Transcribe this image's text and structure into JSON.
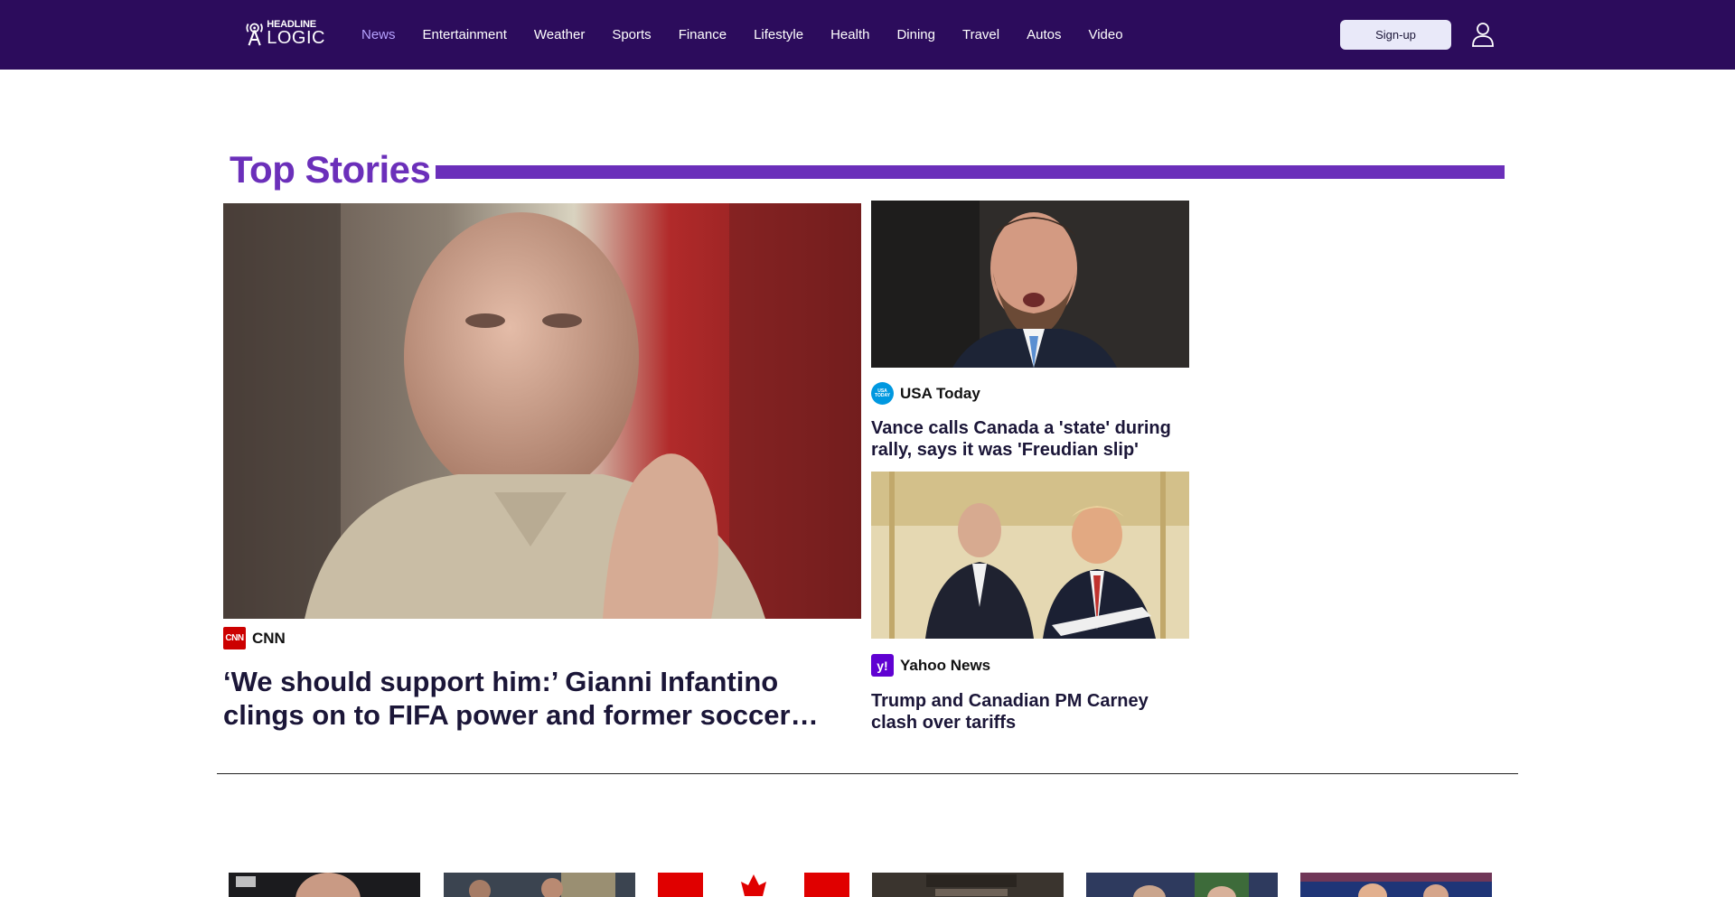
{
  "header": {
    "logo": {
      "line1": "HEADLINE",
      "line2": "LOGIC"
    },
    "nav": [
      {
        "label": "News",
        "active": true
      },
      {
        "label": "Entertainment",
        "active": false
      },
      {
        "label": "Weather",
        "active": false
      },
      {
        "label": "Sports",
        "active": false
      },
      {
        "label": "Finance",
        "active": false
      },
      {
        "label": "Lifestyle",
        "active": false
      },
      {
        "label": "Health",
        "active": false
      },
      {
        "label": "Dining",
        "active": false
      },
      {
        "label": "Travel",
        "active": false
      },
      {
        "label": "Autos",
        "active": false
      },
      {
        "label": "Video",
        "active": false
      }
    ],
    "signup_label": "Sign-up",
    "user_icon": "user-icon"
  },
  "section": {
    "title": "Top Stories"
  },
  "main_story": {
    "source": "CNN",
    "source_logo": "CNN",
    "title": "‘We should support him:’ Gianni Infantino clings on to FIFA power and former soccer officials"
  },
  "side_stories": [
    {
      "source": "USA Today",
      "title": "Vance calls Canada a 'state' during rally, says it was 'Freudian slip'"
    },
    {
      "source": "Yahoo News",
      "title": "Trump and Canadian PM Carney clash over tariffs"
    }
  ],
  "colors": {
    "header_bg": "#2c0c5c",
    "accent": "#6b2fba",
    "nav_active": "#b7a2ff",
    "signup_bg": "#e9e9f9"
  }
}
